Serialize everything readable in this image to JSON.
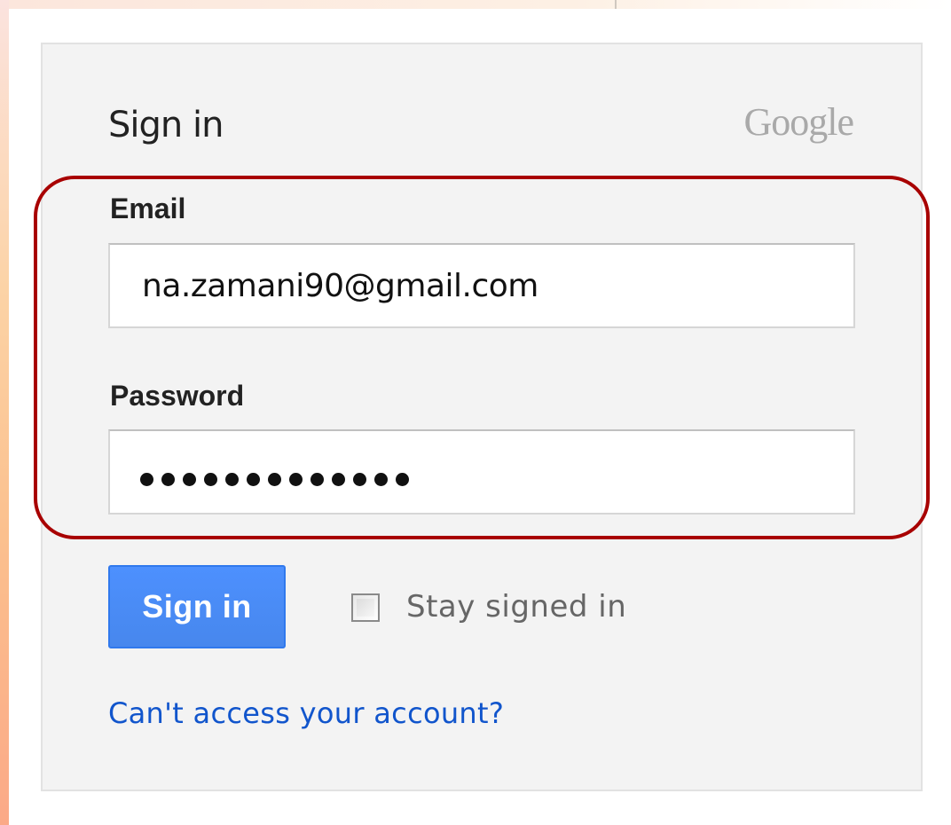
{
  "login": {
    "title": "Sign in",
    "brand": "Google",
    "email_label": "Email",
    "email_value": "na.zamani90@gmail.com",
    "password_label": "Password",
    "password_masked_length": 13,
    "signin_button": "Sign in",
    "stay_signed_in_label": "Stay signed in",
    "stay_signed_in_checked": false,
    "help_link": "Can't access your account?"
  },
  "colors": {
    "primary_button": "#4d90fe",
    "link": "#1155cc",
    "highlight_border": "#a80000",
    "card_background": "#f3f3f3"
  }
}
